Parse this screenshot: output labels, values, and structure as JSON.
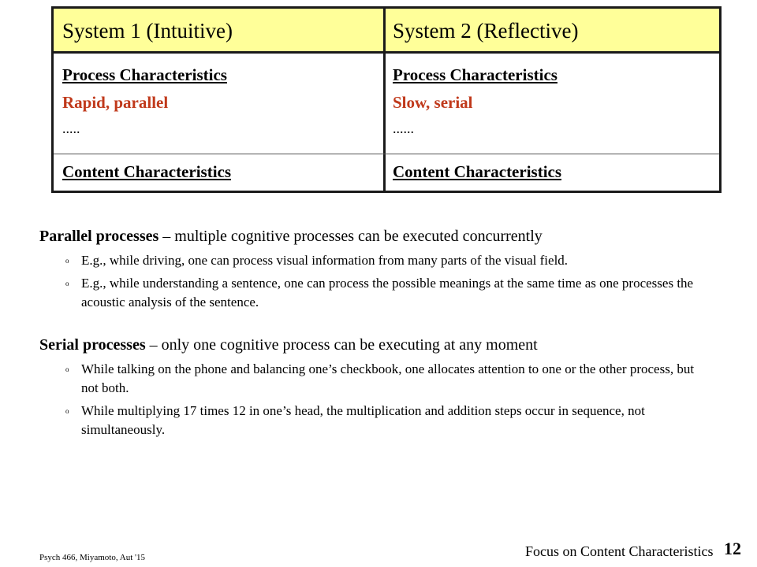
{
  "table": {
    "header_color": "#ffff99",
    "columns": [
      {
        "title": "System 1 (Intuitive)",
        "process_label": "Process Characteristics",
        "process_value": "Rapid, parallel",
        "ellipsis": ".....",
        "content_label": "Content Characteristics"
      },
      {
        "title": "System 2 (Reflective)",
        "process_label": "Process Characteristics",
        "process_value": "Slow, serial",
        "ellipsis": "......",
        "content_label": "Content Characteristics"
      }
    ],
    "highlight_color": "#c0391b"
  },
  "sections": [
    {
      "term": "Parallel processes",
      "definition": " – multiple cognitive processes can be executed concurrently",
      "bullets": [
        "E.g., while driving, one can process visual information from many parts of the visual field.",
        "E.g., while understanding a sentence, one can process the possible meanings at the same time as one processes the acoustic analysis of the sentence."
      ]
    },
    {
      "term": "Serial processes",
      "definition": " – only one cognitive process can be executing at any moment",
      "bullets": [
        "While talking on the phone and balancing one’s checkbook, one allocates attention to one or the other process, but not both.",
        "While multiplying 17 times 12 in one’s head, the multiplication and addition steps occur in sequence, not simultaneously."
      ]
    }
  ],
  "bullet_glyph": "o",
  "footer": {
    "course": "Psych 466, Miyamoto, Aut '15",
    "slide_title": "Focus on Content Characteristics",
    "page_number": "12"
  }
}
